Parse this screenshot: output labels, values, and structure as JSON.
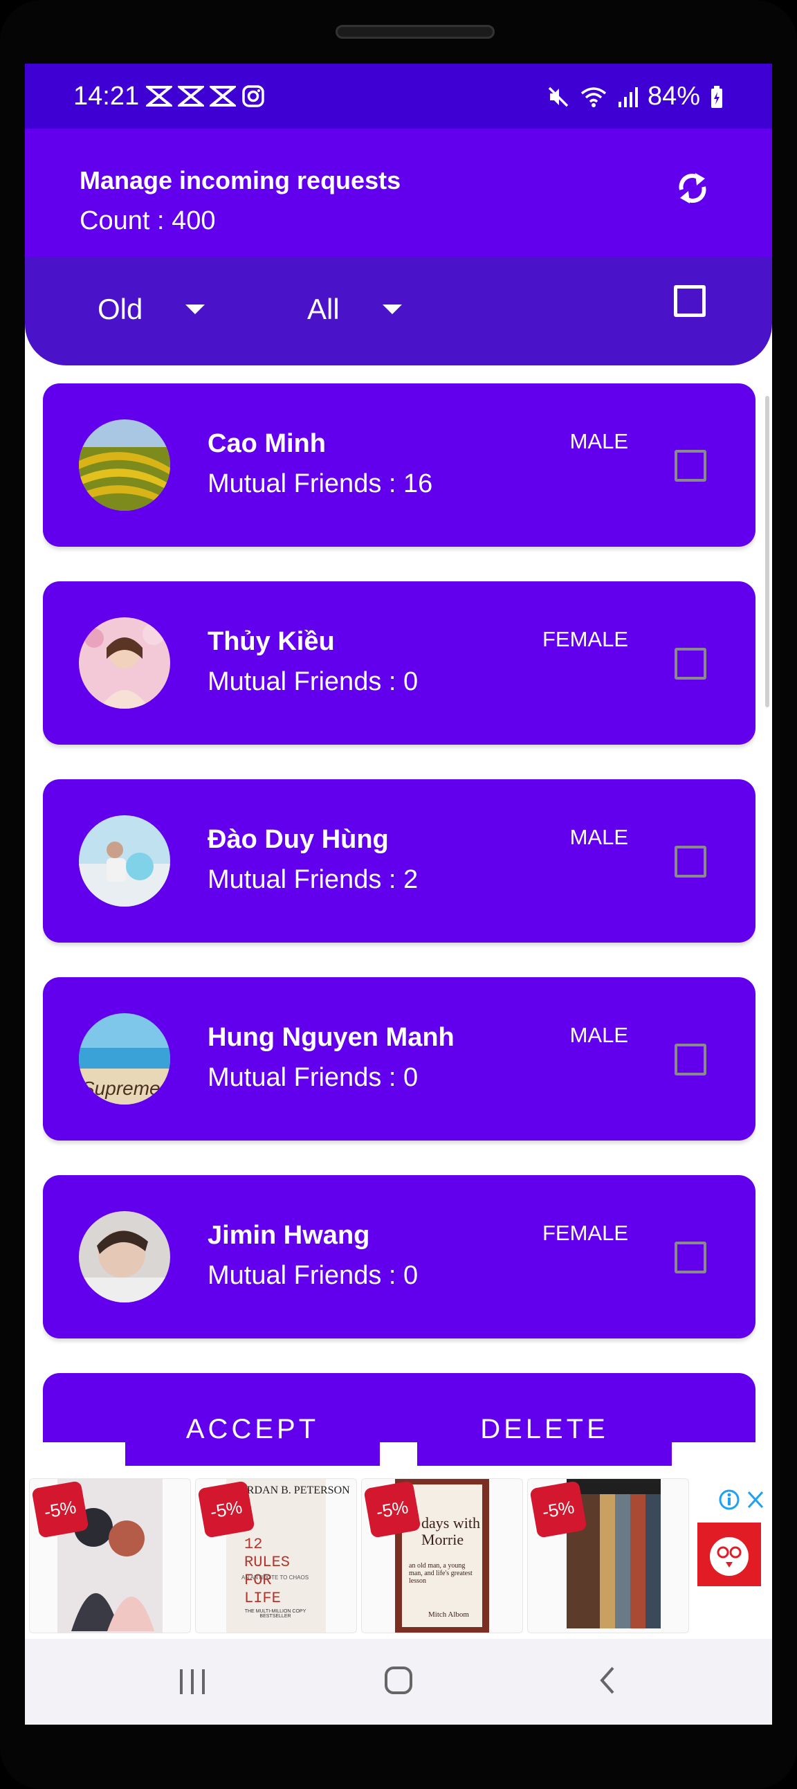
{
  "status_bar": {
    "time": "14:21",
    "battery": "84%",
    "left_icons": [
      "capcut-icon",
      "capcut-icon",
      "capcut-icon",
      "instagram-icon"
    ],
    "right_icons": [
      "mute-icon",
      "wifi-icon",
      "signal-icon",
      "battery-icon"
    ]
  },
  "header": {
    "title": "Manage incoming requests",
    "count": "Count : 400"
  },
  "filters": {
    "sort": "Old",
    "gender": "All"
  },
  "requests": [
    {
      "name": "Cao Minh",
      "mutual": "Mutual Friends : 16",
      "gender": "MALE"
    },
    {
      "name": "Thủy Kiều",
      "mutual": "Mutual Friends : 0",
      "gender": "FEMALE"
    },
    {
      "name": "Đào Duy Hùng",
      "mutual": "Mutual Friends : 2",
      "gender": "MALE"
    },
    {
      "name": "Hung Nguyen Manh",
      "mutual": "Mutual Friends : 0",
      "gender": "MALE"
    },
    {
      "name": "Jimin Hwang",
      "mutual": "Mutual Friends : 0",
      "gender": "FEMALE"
    }
  ],
  "actions": {
    "accept": "ACCEPT",
    "delete": "DELETE"
  },
  "ads": {
    "discount": "-5%",
    "book2_author": "JORDAN B. PETERSON",
    "book2_title": "12 RULES FOR LIFE",
    "book2_subtitle": "AN ANTIDOTE TO CHAOS",
    "book2_footer": "THE MULTI-MILLION COPY BESTSELLER",
    "book3_title": "days with Morrie",
    "book3_subtitle": "an old man, a young man, and life's greatest lesson",
    "book3_author": "Mitch Albom"
  },
  "colors": {
    "primary": "#6200ee",
    "status_bar": "#3f00d4",
    "filter_bar": "#4a12c9"
  }
}
